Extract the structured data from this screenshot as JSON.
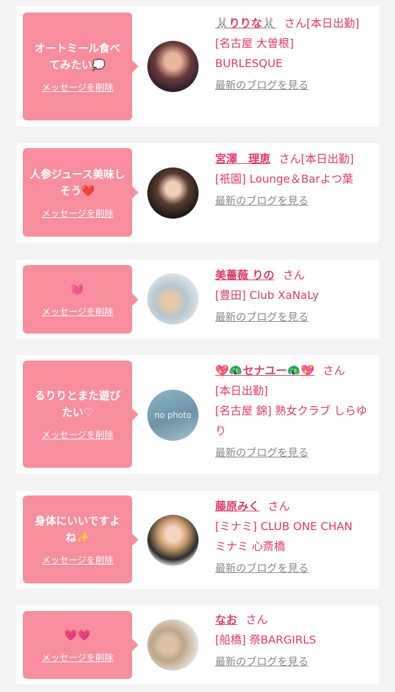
{
  "delete_label": "メッセージを削除",
  "blog_label": "最新のブログを見る",
  "san": "さん",
  "no_photo_text": "no photo",
  "accent_color": "#e03a6a",
  "bubble_color": "#f88e9d",
  "cards": [
    {
      "message": "オートミール食べてみたい💭",
      "name": "🐰りりな🐰",
      "line1": "[本日出勤]",
      "line2": "[名古屋 大曽根] BURLESQUE"
    },
    {
      "message": "人参ジュース美味しそう❤️",
      "name": "宮澤　理恵",
      "line1": "[本日出勤]",
      "line2": "[祇園] Lounge＆Barよつ葉"
    },
    {
      "message": "💓",
      "name": "美薔薇 りの",
      "line1": "",
      "line2": "[豊田] Club XaNaLy"
    },
    {
      "message": "るりりとまた遊びたい♡",
      "name": "💖🦚セナユー🦚💖",
      "line1": "[本日出勤]",
      "line2": "[名古屋 錦] 熟女クラブ しらゆり"
    },
    {
      "message": "身体にいいですよね✨",
      "name": "藤原みく",
      "line1": "",
      "line2": "[ミナミ] CLUB ONE CHAN ミナミ 心斎橋"
    },
    {
      "message": "💗💗",
      "name": "なお",
      "line1": "",
      "line2": "[船橋] 祭BARGIRLS"
    }
  ]
}
